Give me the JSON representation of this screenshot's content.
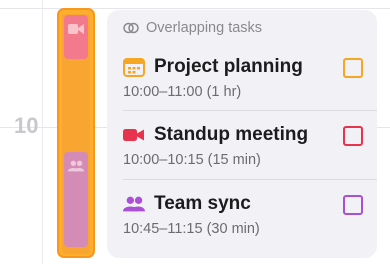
{
  "timeline": {
    "hour_label": "10"
  },
  "card": {
    "header": "Overlapping tasks",
    "tasks": [
      {
        "title": "Project planning",
        "time": "10:00–11:00 (1 hr)",
        "icon": "calendar-icon",
        "color": "#f5a623"
      },
      {
        "title": "Standup meeting",
        "time": "10:00–10:15 (15 min)",
        "icon": "video-camera-icon",
        "color": "#e8334f"
      },
      {
        "title": "Team sync",
        "time": "10:45–11:15 (30 min)",
        "icon": "people-icon",
        "color": "#a950d6"
      }
    ]
  }
}
